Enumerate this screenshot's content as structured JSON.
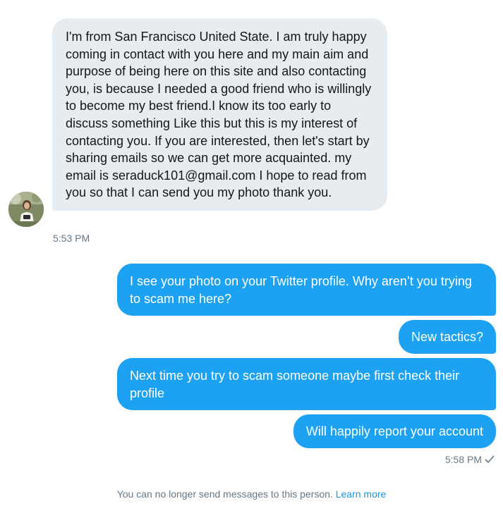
{
  "conversation": {
    "incoming": {
      "text": "I'm from San Francisco United State. I am truly happy coming in contact with you here and my main aim and purpose of being here on this site and also contacting you, is because I needed a good friend who is willingly to become my best friend.I know its too early to discuss something Like this but this is my interest of contacting you. If you are interested, then let's start by sharing emails so we can get more acquainted. my email is seraduck101@gmail.com I hope to read from you so that I can send you my photo thank you.",
      "timestamp": "5:53 PM"
    },
    "outgoing": [
      {
        "text": "I see your photo on your Twitter profile. Why aren’t you trying to scam me here?"
      },
      {
        "text": "New tactics?"
      },
      {
        "text": "Next time you try to scam someone maybe first check their profile"
      },
      {
        "text": "Will happily report your account"
      }
    ],
    "outgoing_timestamp": "5:58 PM",
    "read_indicator_icon": "checkmark-icon"
  },
  "footer": {
    "notice": "You can no longer send messages to this person.",
    "link_label": "Learn more"
  },
  "colors": {
    "incoming_bubble": "#e6ecf0",
    "outgoing_bubble": "#1da1f2",
    "muted_text": "#657786",
    "link": "#1b95e0"
  }
}
